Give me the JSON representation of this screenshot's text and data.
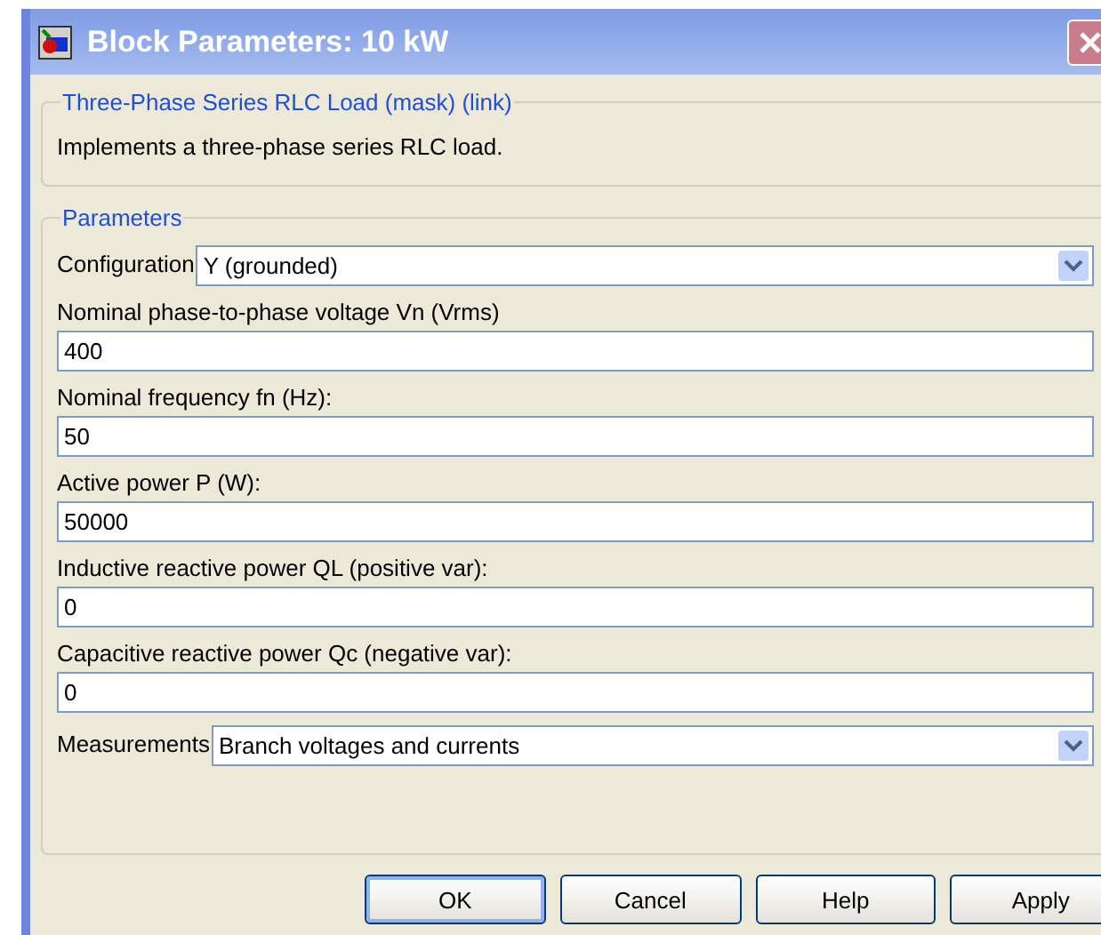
{
  "window": {
    "title": "Block Parameters: 10 kW"
  },
  "description_group": {
    "title": "Three-Phase Series RLC Load (mask) (link)",
    "text": "Implements a three-phase series RLC load."
  },
  "parameters_group": {
    "title": "Parameters",
    "fields": [
      {
        "kind": "dropdown",
        "label": "Configuration",
        "value": "Y (grounded)"
      },
      {
        "kind": "text",
        "label": "Nominal phase-to-phase voltage Vn (Vrms)",
        "value": "400"
      },
      {
        "kind": "text",
        "label": "Nominal frequency fn (Hz):",
        "value": "50"
      },
      {
        "kind": "text",
        "label": "Active power P (W):",
        "value": "50000"
      },
      {
        "kind": "text",
        "label": "Inductive reactive power QL (positive var):",
        "value": "0"
      },
      {
        "kind": "text",
        "label": "Capacitive reactive power Qc (negative var):",
        "value": "0"
      },
      {
        "kind": "dropdown",
        "label": "Measurements",
        "value": "Branch voltages and currents"
      }
    ]
  },
  "buttons": [
    {
      "label": "OK",
      "default": true
    },
    {
      "label": "Cancel",
      "default": false
    },
    {
      "label": "Help",
      "default": false
    },
    {
      "label": "Apply",
      "default": false
    }
  ]
}
